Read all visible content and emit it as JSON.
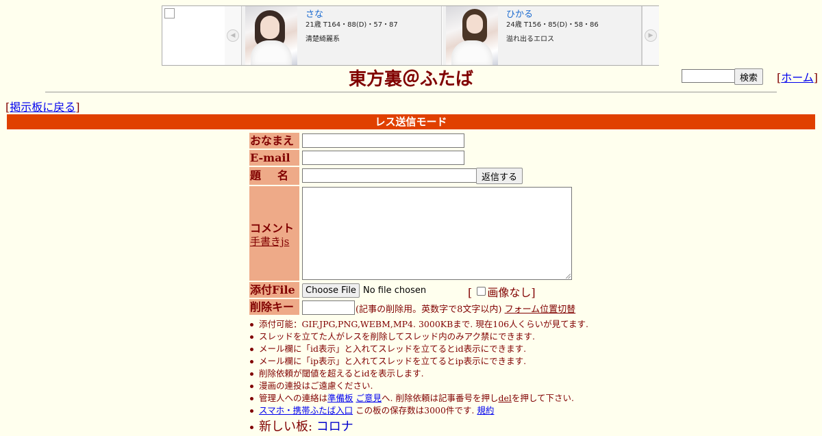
{
  "banner": {
    "cards": [
      {
        "name": "さな",
        "stats": "21歳 T164・88(D)・57・87",
        "desc": "清楚綺麗系"
      },
      {
        "name": "ひかる",
        "stats": "24歳 T156・85(D)・58・86",
        "desc": "溢れ出るエロス"
      }
    ]
  },
  "header": {
    "title": "東方裏＠ふたば",
    "search_button": "検索",
    "home_open": "[",
    "home_label": "ホーム",
    "home_close": "]",
    "back_open": "[",
    "back_label": "掲示板に戻る",
    "back_close": "]"
  },
  "mode_bar": "レス送信モード",
  "form": {
    "name_label": "おなまえ",
    "email_label": "E-mail",
    "subject_label_1": "題",
    "subject_label_2": "名",
    "submit_label": "返信する",
    "comment_label": "コメント",
    "handwriting_link": "手書きjs",
    "file_label": "添付File",
    "file_button": "Choose File",
    "file_status": "No file chosen",
    "noimage_open": "[",
    "noimage_label": "画像なし]",
    "delkey_label": "削除キー",
    "delkey_note": "(記事の削除用。英数字で8文字以内)",
    "form_position_link": "フォーム位置切替"
  },
  "rules": {
    "r1": "添付可能：GIF,JPG,PNG,WEBM,MP4. 3000KBまで. 現在106人くらいが見てます.",
    "r2": "スレッドを立てた人がレスを削除してスレッド内のみアク禁にできます.",
    "r3": "メール欄に「id表示」と入れてスレッドを立てるとid表示にできます.",
    "r4": "メール欄に「ip表示」と入れてスレッドを立てるとip表示にできます.",
    "r5": "削除依頼が閾値を超えるとidを表示します.",
    "r6": "漫画の連投はご遠慮ください.",
    "r7_a": "管理人への連絡は",
    "r7_link1": "準備板",
    "r7_link2": "ご意見",
    "r7_b": "へ. 削除依頼は記事番号を押し",
    "r7_del": "del",
    "r7_c": "を押して下さい.",
    "r8_link": "スマホ・携帯ふたば入口",
    "r8_text": "この板の保存数は3000件です.",
    "r8_rules": "規約",
    "r9_text": "新しい板: ",
    "r9_link": "コロナ"
  }
}
